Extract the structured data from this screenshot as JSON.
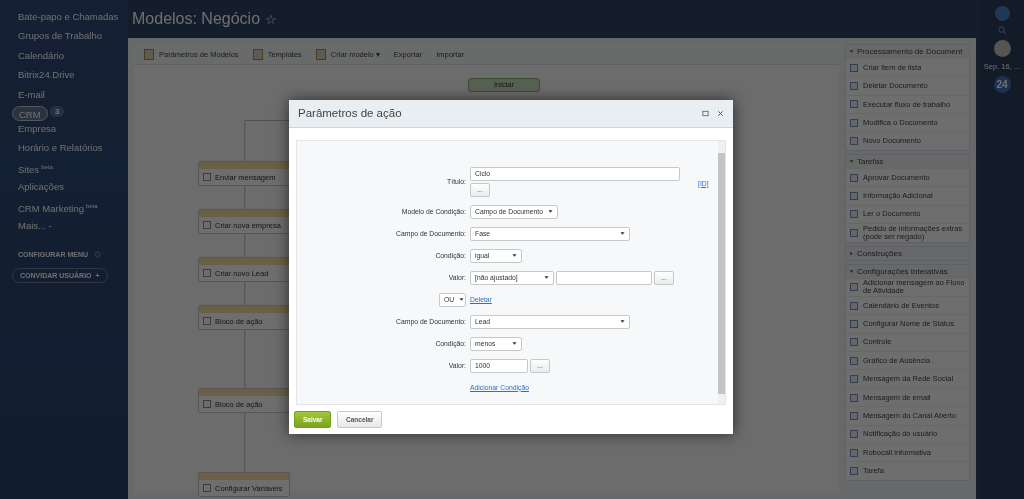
{
  "sidebar": {
    "items": [
      {
        "label": "Bate-papo e Chamadas",
        "selected": false
      },
      {
        "label": "Grupos de Trabalho",
        "selected": false
      },
      {
        "label": "Calendário",
        "selected": false
      },
      {
        "label": "Bitrix24.Drive",
        "selected": false
      },
      {
        "label": "E-mail",
        "selected": false
      },
      {
        "label": "CRM",
        "badge": "3",
        "selected": true
      },
      {
        "label": "Empresa",
        "selected": false
      },
      {
        "label": "Horário e Relatórios",
        "selected": false
      },
      {
        "label": "Sites",
        "sup": "beta",
        "selected": false
      },
      {
        "label": "Aplicações",
        "selected": false
      },
      {
        "label": "CRM Marketing",
        "sup": "beta",
        "selected": false
      },
      {
        "label": "Mais... -",
        "selected": false
      }
    ],
    "configure_menu": "CONFIGURAR MENU",
    "invite": "CONVIDAR USUÁRIO",
    "invite_plus": "+"
  },
  "page": {
    "title": "Modelos: Negócio",
    "star": "☆"
  },
  "toolbar": [
    {
      "label": "Parâmetros de Modelos",
      "kind": "icon"
    },
    {
      "label": "Templates",
      "kind": "icon"
    },
    {
      "label": "Criar modelo ▾",
      "kind": "icon"
    },
    {
      "label": "Exportar",
      "kind": "plain"
    },
    {
      "label": "Importar",
      "kind": "plain"
    }
  ],
  "diagram": {
    "start": "Iniciar",
    "blocks": [
      "Enviar mensagem",
      "Criar nova empresa",
      "Criar novo Lead",
      "Bloco de ação",
      "Bloco de ação",
      "Configurar Variáveis"
    ]
  },
  "palette": [
    {
      "title": "Processamento de Document",
      "expanded": true,
      "items": [
        "Criar item de lista",
        "Deletar Documento",
        "Executar fluxo de trabalho",
        "Modifica o Documento",
        "Novo Documento"
      ]
    },
    {
      "title": "Tarefas",
      "expanded": true,
      "items": [
        "Aprovar Documento",
        "Informação Adicional",
        "Ler o Documento",
        "Pedido de informações extras (pode ser negado)"
      ]
    },
    {
      "title": "Construções",
      "expanded": false
    },
    {
      "title": "Configurações Interativas",
      "expanded": true,
      "items": [
        "Adicionar mensagem ao Fluxo de Atividade",
        "Calendário de Eventos",
        "Configurar Nome de Status",
        "Controle",
        "Gráfico de Ausência",
        "Mensagem da Rede Social",
        "Mensagem de email",
        "Mensagem do Canal Aberto",
        "Notificação do usuário",
        "Robocall informativa",
        "Tarefa"
      ]
    }
  ],
  "right_bar": {
    "date": "Sep. 16, ...",
    "counter": "24"
  },
  "dialog": {
    "title": "Parâmetros de ação",
    "rows": [
      {
        "kind": "title",
        "label": "Título:",
        "value": "Ciclo",
        "button": "...",
        "link": "[ID]"
      },
      {
        "kind": "select",
        "label": "Modelo de Condição:",
        "value": "Campo de Documento"
      },
      {
        "kind": "wideselect",
        "label": "Campo de Documento:",
        "value": "Fase"
      },
      {
        "kind": "narrowselect",
        "label": "Condição:",
        "value": "igual"
      },
      {
        "kind": "valuepick",
        "label": "Valor:",
        "value": "[não ajustado]",
        "button": "..."
      },
      {
        "kind": "logic",
        "value": "OU",
        "link": "Deletar"
      },
      {
        "kind": "wideselect",
        "label": "Campo de Documento:",
        "value": "Lead"
      },
      {
        "kind": "narrowselect",
        "label": "Condição:",
        "value": "menos"
      },
      {
        "kind": "input",
        "label": "Valor:",
        "value": "1000",
        "button": "..."
      },
      {
        "kind": "addlink",
        "link": "Adicionar Condição"
      }
    ],
    "buttons": [
      {
        "label": "Salvar",
        "kind": "primary"
      },
      {
        "label": "Cancelar",
        "kind": "secondary"
      }
    ]
  }
}
